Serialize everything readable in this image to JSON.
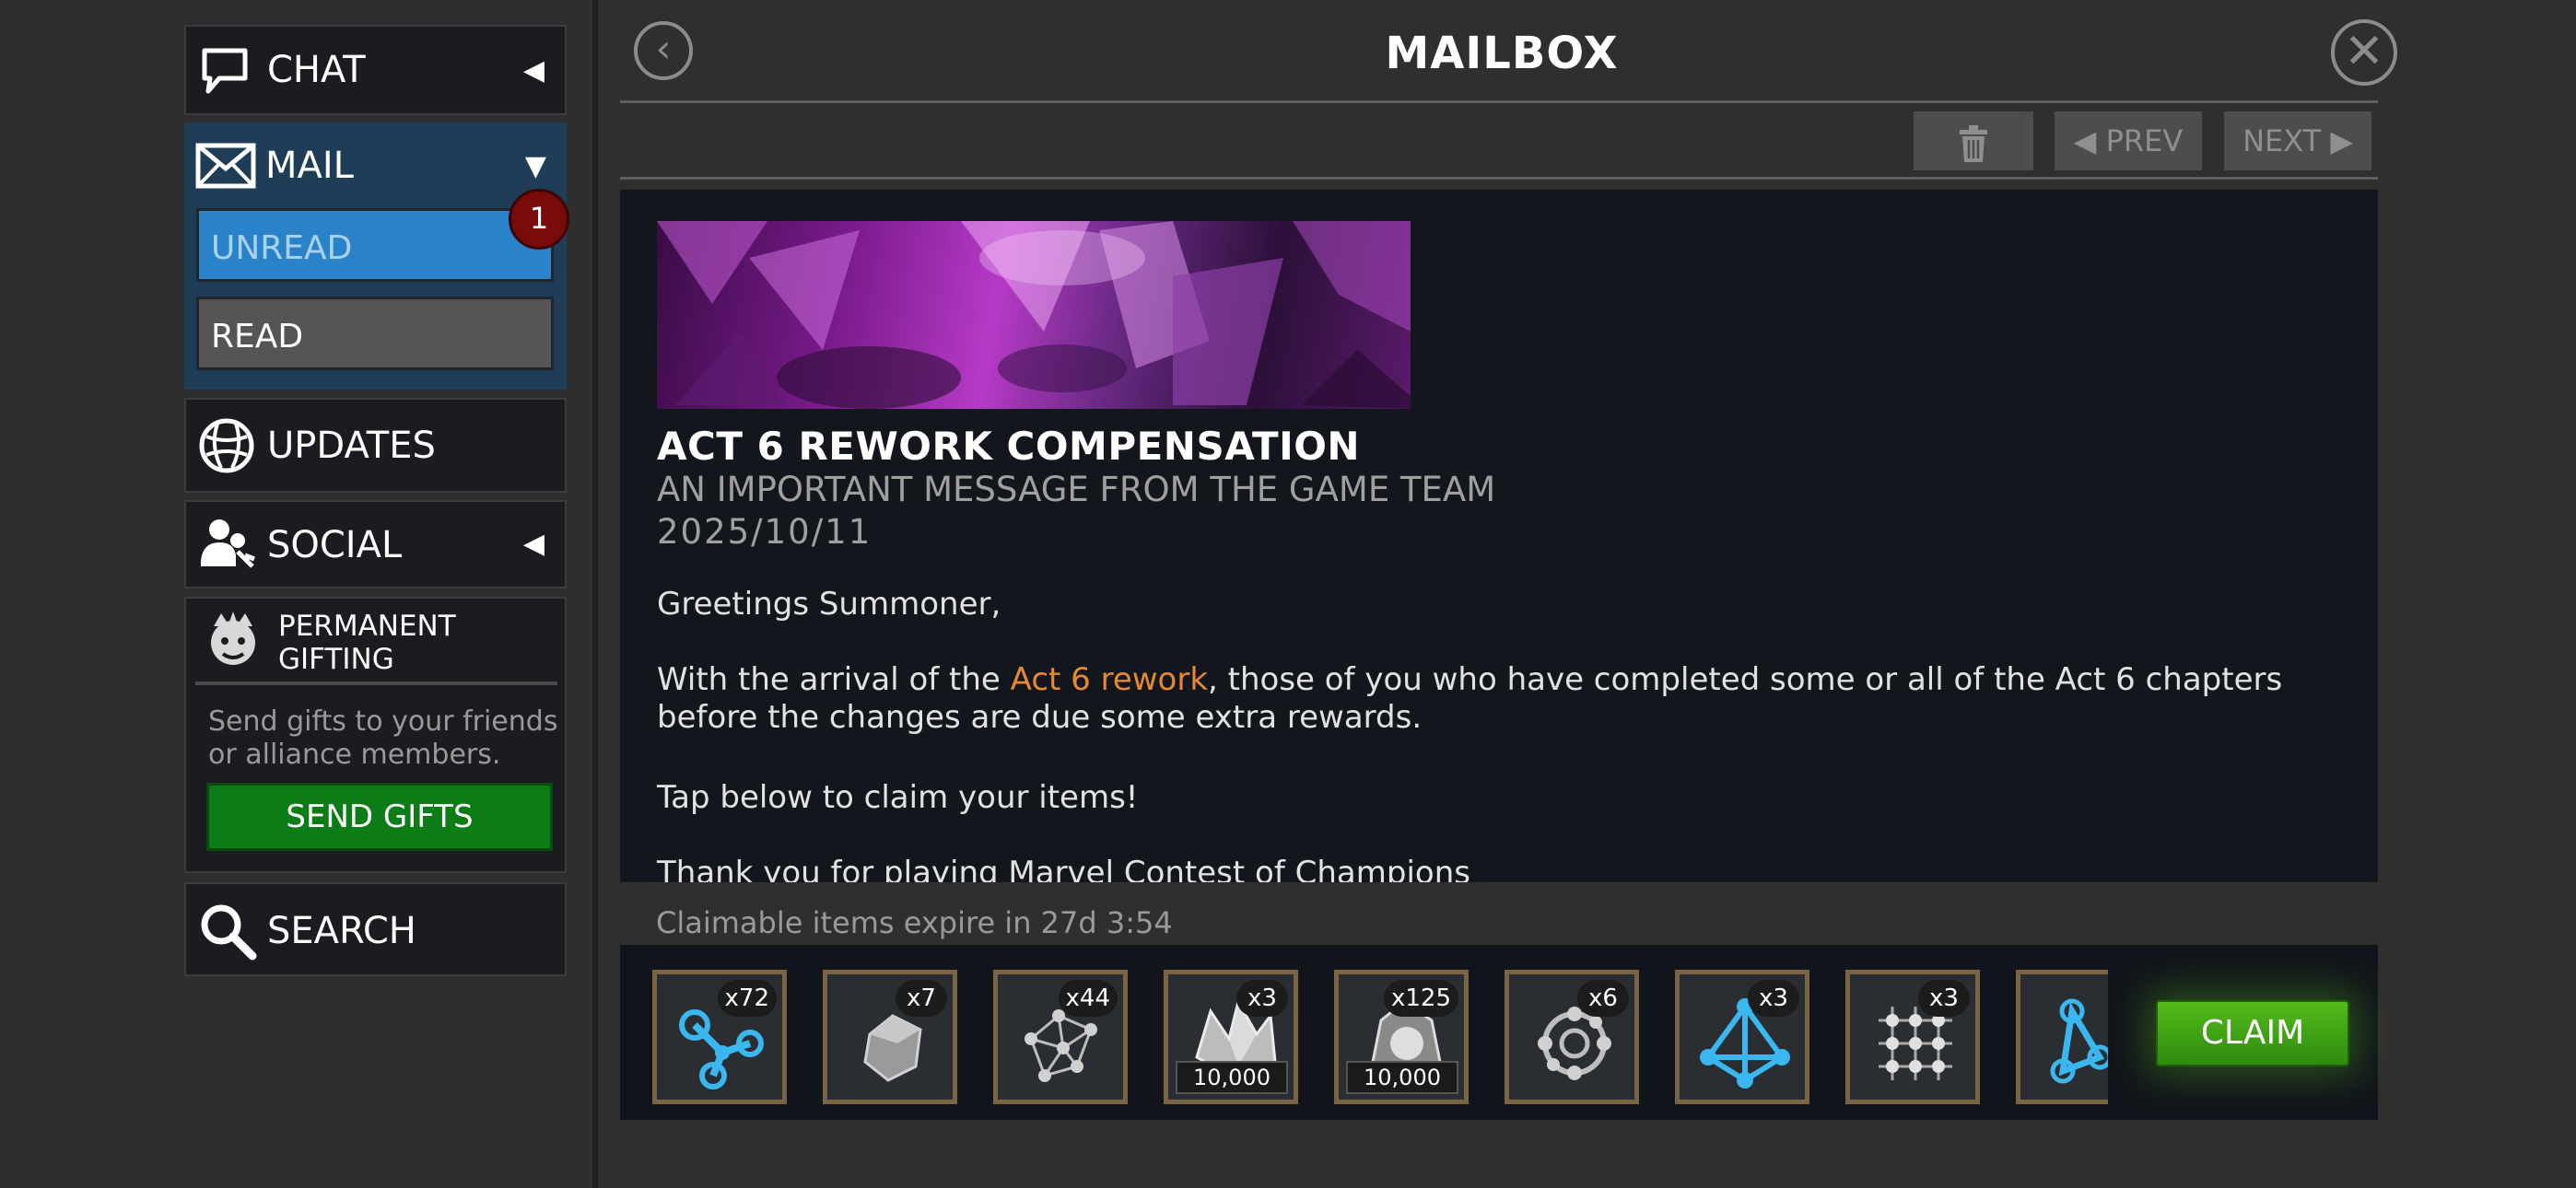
{
  "sidebar": {
    "chat_label": "CHAT",
    "mail_label": "MAIL",
    "unread_label": "UNREAD",
    "unread_count": "1",
    "read_label": "READ",
    "updates_label": "UPDATES",
    "social_label": "SOCIAL",
    "gifting_title": "PERMANENT GIFTING",
    "gifting_desc": "Send gifts to your friends or alliance members.",
    "send_gifts_label": "SEND GIFTS",
    "search_label": "SEARCH"
  },
  "header": {
    "title": "MAILBOX",
    "prev_label": "◀ PREV",
    "next_label": "NEXT ▶"
  },
  "message": {
    "title": "ACT 6 REWORK COMPENSATION",
    "subtitle": "AN IMPORTANT MESSAGE FROM THE GAME TEAM",
    "date": "2025/10/11",
    "greeting": "Greetings Summoner,",
    "p2_before": "With the arrival of the ",
    "p2_highlight": "Act 6 rework",
    "p2_after": ", those of you who have completed some or all of the Act 6 chapters before the changes are due some extra rewards.",
    "p3": "Tap below to claim your items!",
    "p4": "Thank you for playing Marvel Contest of Champions"
  },
  "rewards": {
    "expire_text": "Claimable items expire in 27d 3:54",
    "items": [
      {
        "qty": "x72",
        "icon": "blue-catalyst-icon"
      },
      {
        "qty": "x7",
        "icon": "ore-chunk-icon"
      },
      {
        "qty": "x44",
        "icon": "grey-catalyst-icon"
      },
      {
        "qty": "x3",
        "value": "10,000",
        "icon": "crystal-shard-icon"
      },
      {
        "qty": "x125",
        "value": "10,000",
        "icon": "crystal-orb-icon"
      },
      {
        "qty": "x6",
        "icon": "ring-catalyst-icon"
      },
      {
        "qty": "x3",
        "icon": "blue-pyramid-catalyst-icon"
      },
      {
        "qty": "x3",
        "icon": "grid-catalyst-icon"
      },
      {
        "qty": "",
        "icon": "blue-catalyst-icon"
      }
    ],
    "claim_label": "CLAIM"
  },
  "colors": {
    "accent_unread": "#2a83c9",
    "highlight": "#e7892f",
    "claim_green": "#53bb1a",
    "send_gifts_green": "#0c7d16"
  }
}
